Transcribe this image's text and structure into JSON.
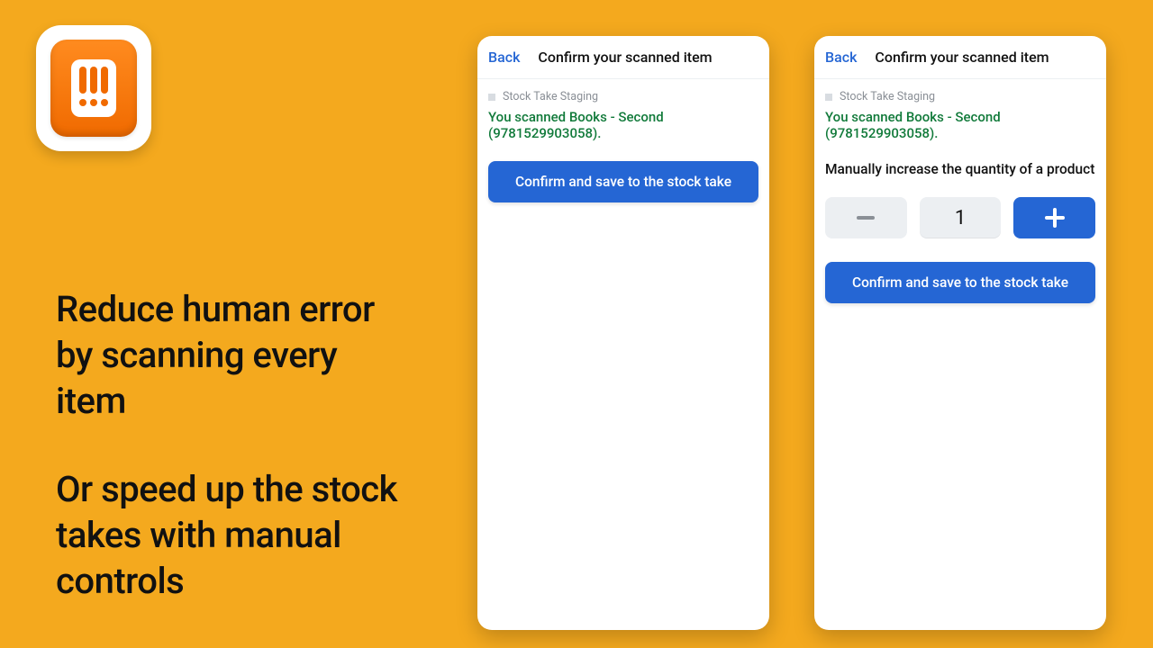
{
  "colors": {
    "page_bg": "#f4a91e",
    "accent": "#2566d4",
    "success_text": "#117a3a"
  },
  "app_icon": {
    "name": "stock-take-app-icon"
  },
  "headline": {
    "line1": "Reduce human error by scanning every item",
    "line2": "Or speed up the stock takes with manual controls"
  },
  "panels": {
    "left": {
      "back_label": "Back",
      "title": "Confirm your scanned item",
      "breadcrumb": "Stock Take Staging",
      "scan_message": "You scanned Books - Second (9781529903058).",
      "confirm_label": "Confirm and save to the stock take"
    },
    "right": {
      "back_label": "Back",
      "title": "Confirm your scanned item",
      "breadcrumb": "Stock Take Staging",
      "scan_message": "You scanned Books - Second (9781529903058).",
      "manual_instruction": "Manually increase the quantity of a product",
      "quantity_value": "1",
      "confirm_label": "Confirm and save to the stock take"
    }
  }
}
